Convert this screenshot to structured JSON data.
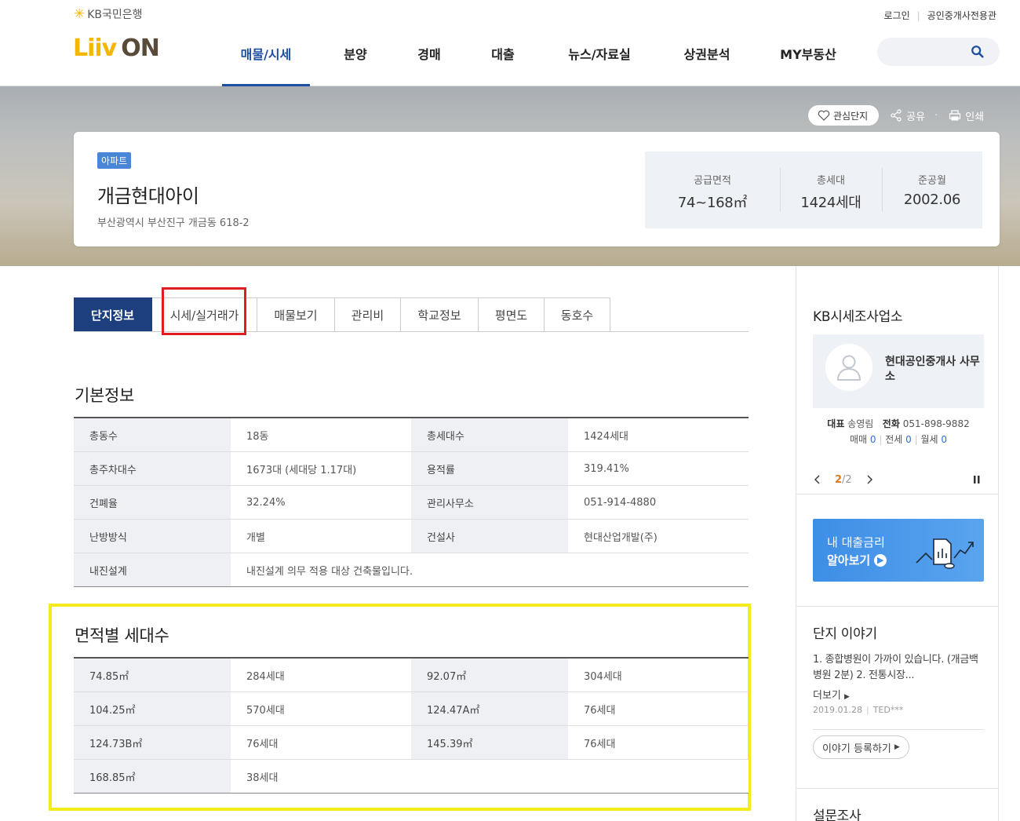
{
  "header": {
    "kb_logo": "KB국민은행",
    "liiv": "Liiv",
    "on": "ON",
    "login": "로그인",
    "agent_only": "공인중개사전용관",
    "nav": [
      "매물/시세",
      "분양",
      "경매",
      "대출",
      "뉴스/자료실",
      "상권분석",
      "MY부동산"
    ]
  },
  "hero": {
    "favorite": "관심단지",
    "share": "공유",
    "print": "인쇄"
  },
  "complex": {
    "type": "아파트",
    "name": "개금현대아이",
    "address": "부산광역시 부산진구 개금동 618-2",
    "stats": [
      {
        "label": "공급면적",
        "value": "74~168㎡"
      },
      {
        "label": "총세대",
        "value": "1424세대"
      },
      {
        "label": "준공월",
        "value": "2002.06"
      }
    ]
  },
  "tabs": [
    "단지정보",
    "시세/실거래가",
    "매물보기",
    "관리비",
    "학교정보",
    "평면도",
    "동호수"
  ],
  "basic": {
    "title": "기본정보",
    "rows": [
      [
        "총동수",
        "18동",
        "총세대수",
        "1424세대"
      ],
      [
        "총주차대수",
        "1673대 (세대당 1.17대)",
        "용적률",
        "319.41%"
      ],
      [
        "건폐율",
        "32.24%",
        "관리사무소",
        "051-914-4880"
      ],
      [
        "난방방식",
        "개별",
        "건설사",
        "현대산업개발(주)"
      ]
    ],
    "seismic_label": "내진설계",
    "seismic_value": "내진설계 의무 적용 대상 건축물입니다."
  },
  "area": {
    "title": "면적별 세대수",
    "rows": [
      [
        "74.85㎡",
        "284세대",
        "92.07㎡",
        "304세대"
      ],
      [
        "104.25㎡",
        "570세대",
        "124.47A㎡",
        "76세대"
      ],
      [
        "124.73B㎡",
        "76세대",
        "145.39㎡",
        "76세대"
      ],
      [
        "168.85㎡",
        "38세대",
        "",
        ""
      ]
    ]
  },
  "sidebar": {
    "survey_title": "KB시세조사업소",
    "agent_name": "현대공인중개사 사무소",
    "rep_label": "대표",
    "rep_name": "송영림",
    "tel_label": "전화",
    "tel": "051-898-9882",
    "sale_label": "매매",
    "sale_count": "0",
    "jeonse_label": "전세",
    "jeonse_count": "0",
    "monthly_label": "월세",
    "monthly_count": "0",
    "page_current": "2",
    "page_total": "/2",
    "loan_line1": "내 대출금리",
    "loan_line2": "알아보기",
    "story_title": "단지 이야기",
    "story_text": "1. 종합병원이 가까이 있습니다. (개금백병원 2분) 2. 전통시장...",
    "more": "더보기",
    "story_date": "2019.01.28",
    "story_user": "TED***",
    "story_register": "이야기 등록하기",
    "survey2_title": "설문조사"
  }
}
